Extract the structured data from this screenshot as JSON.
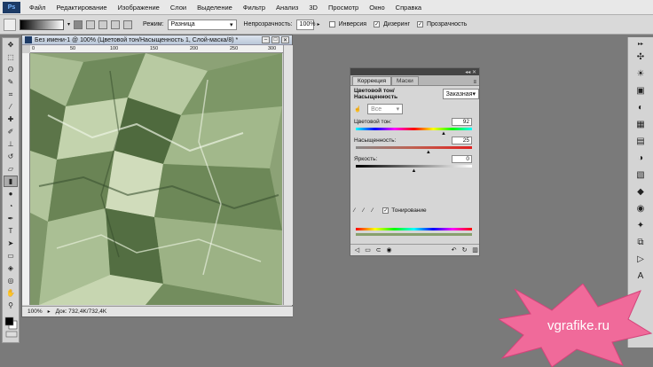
{
  "menubar": {
    "logo": "Ps",
    "items": [
      "Файл",
      "Редактирование",
      "Изображение",
      "Слои",
      "Выделение",
      "Фильтр",
      "Анализ",
      "3D",
      "Просмотр",
      "Окно",
      "Справка"
    ]
  },
  "options": {
    "mode_label": "Режим:",
    "mode_value": "Разница",
    "opacity_label": "Непрозрачность:",
    "opacity_value": "100%",
    "inversion_label": "Инверсия",
    "dither_label": "Дизеринг",
    "transparency_label": "Прозрачность"
  },
  "document": {
    "title": "Без имени-1 @ 100% (Цветовой тон/Насыщенность 1, Слой-маска/8) *",
    "ruler_marks": [
      "0",
      "50",
      "100",
      "150",
      "200",
      "250",
      "300"
    ],
    "zoom": "100%",
    "doc_info": "Док: 732,4K/732,4K"
  },
  "panel": {
    "tab_correction": "Коррекция",
    "tab_masks": "Маски",
    "header": "Цветовой тон/Насыщенность",
    "preset": "Заказная",
    "channel": "Все",
    "hue_label": "Цветовой тон:",
    "hue_value": "92",
    "saturation_label": "Насыщенность:",
    "saturation_value": "25",
    "lightness_label": "Яркость:",
    "lightness_value": "0",
    "colorize_label": "Тонирование",
    "hue_range": [
      -180,
      180
    ],
    "saturation_range": [
      -100,
      100
    ],
    "lightness_range": [
      -100,
      100
    ]
  },
  "watermark": {
    "text": "vgrafike.ru"
  }
}
